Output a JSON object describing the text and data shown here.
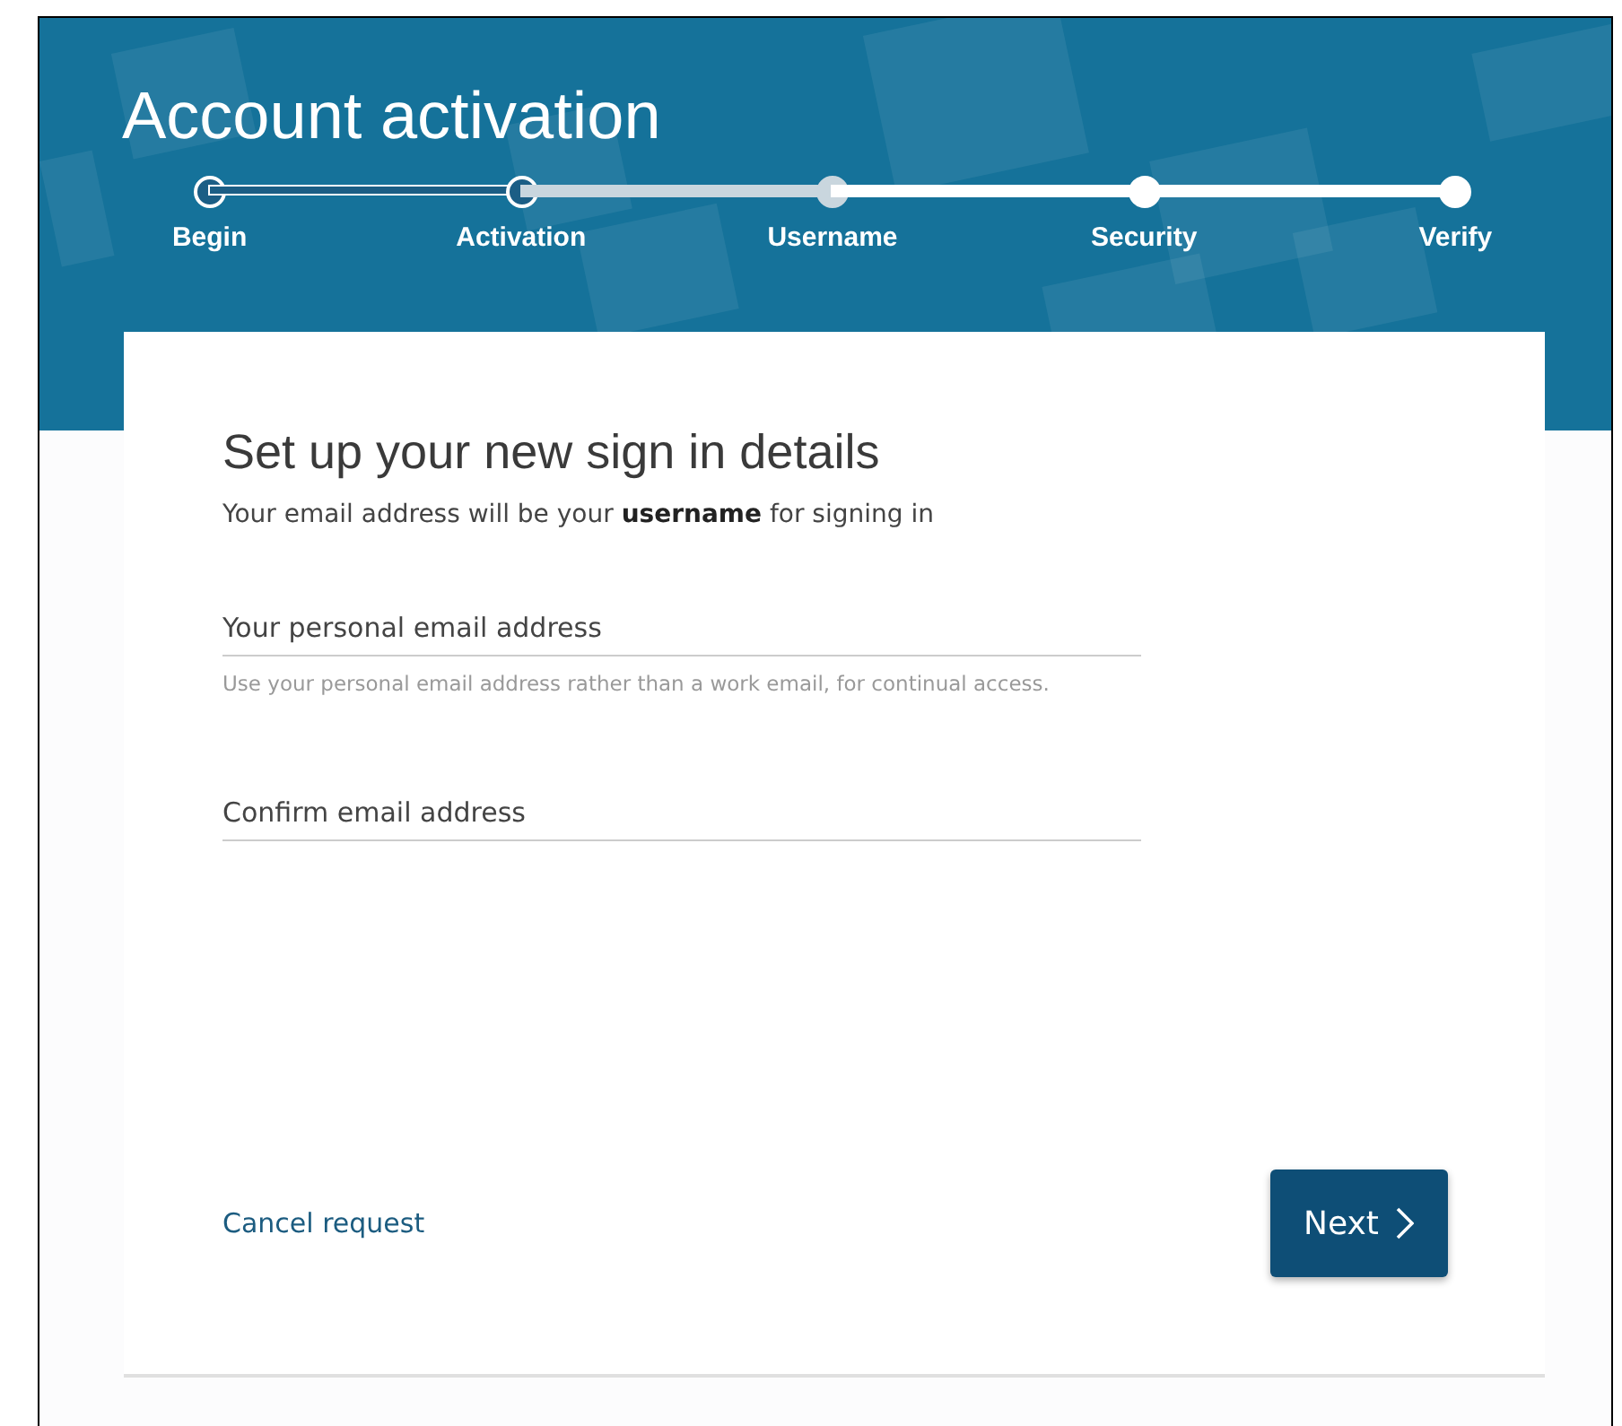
{
  "header": {
    "title": "Account activation"
  },
  "steps": [
    {
      "label": "Begin",
      "completed": true,
      "selected": false
    },
    {
      "label": "Activation",
      "completed": true,
      "selected": false
    },
    {
      "label": "Username",
      "completed": false,
      "selected": true
    },
    {
      "label": "Security",
      "completed": false,
      "selected": false
    },
    {
      "label": "Verify",
      "completed": false,
      "selected": false
    }
  ],
  "form": {
    "heading": "Set up your new sign in details",
    "intro": "Your email address will be your **username** for signing in",
    "fields": [
      {
        "placeholder": "Your personal email address",
        "hint": "Use your personal email address rather than a work email, for continual access."
      },
      {
        "placeholder": "Confirm email address"
      }
    ],
    "cancel_link": "Cancel request",
    "next_button": "Next"
  }
}
